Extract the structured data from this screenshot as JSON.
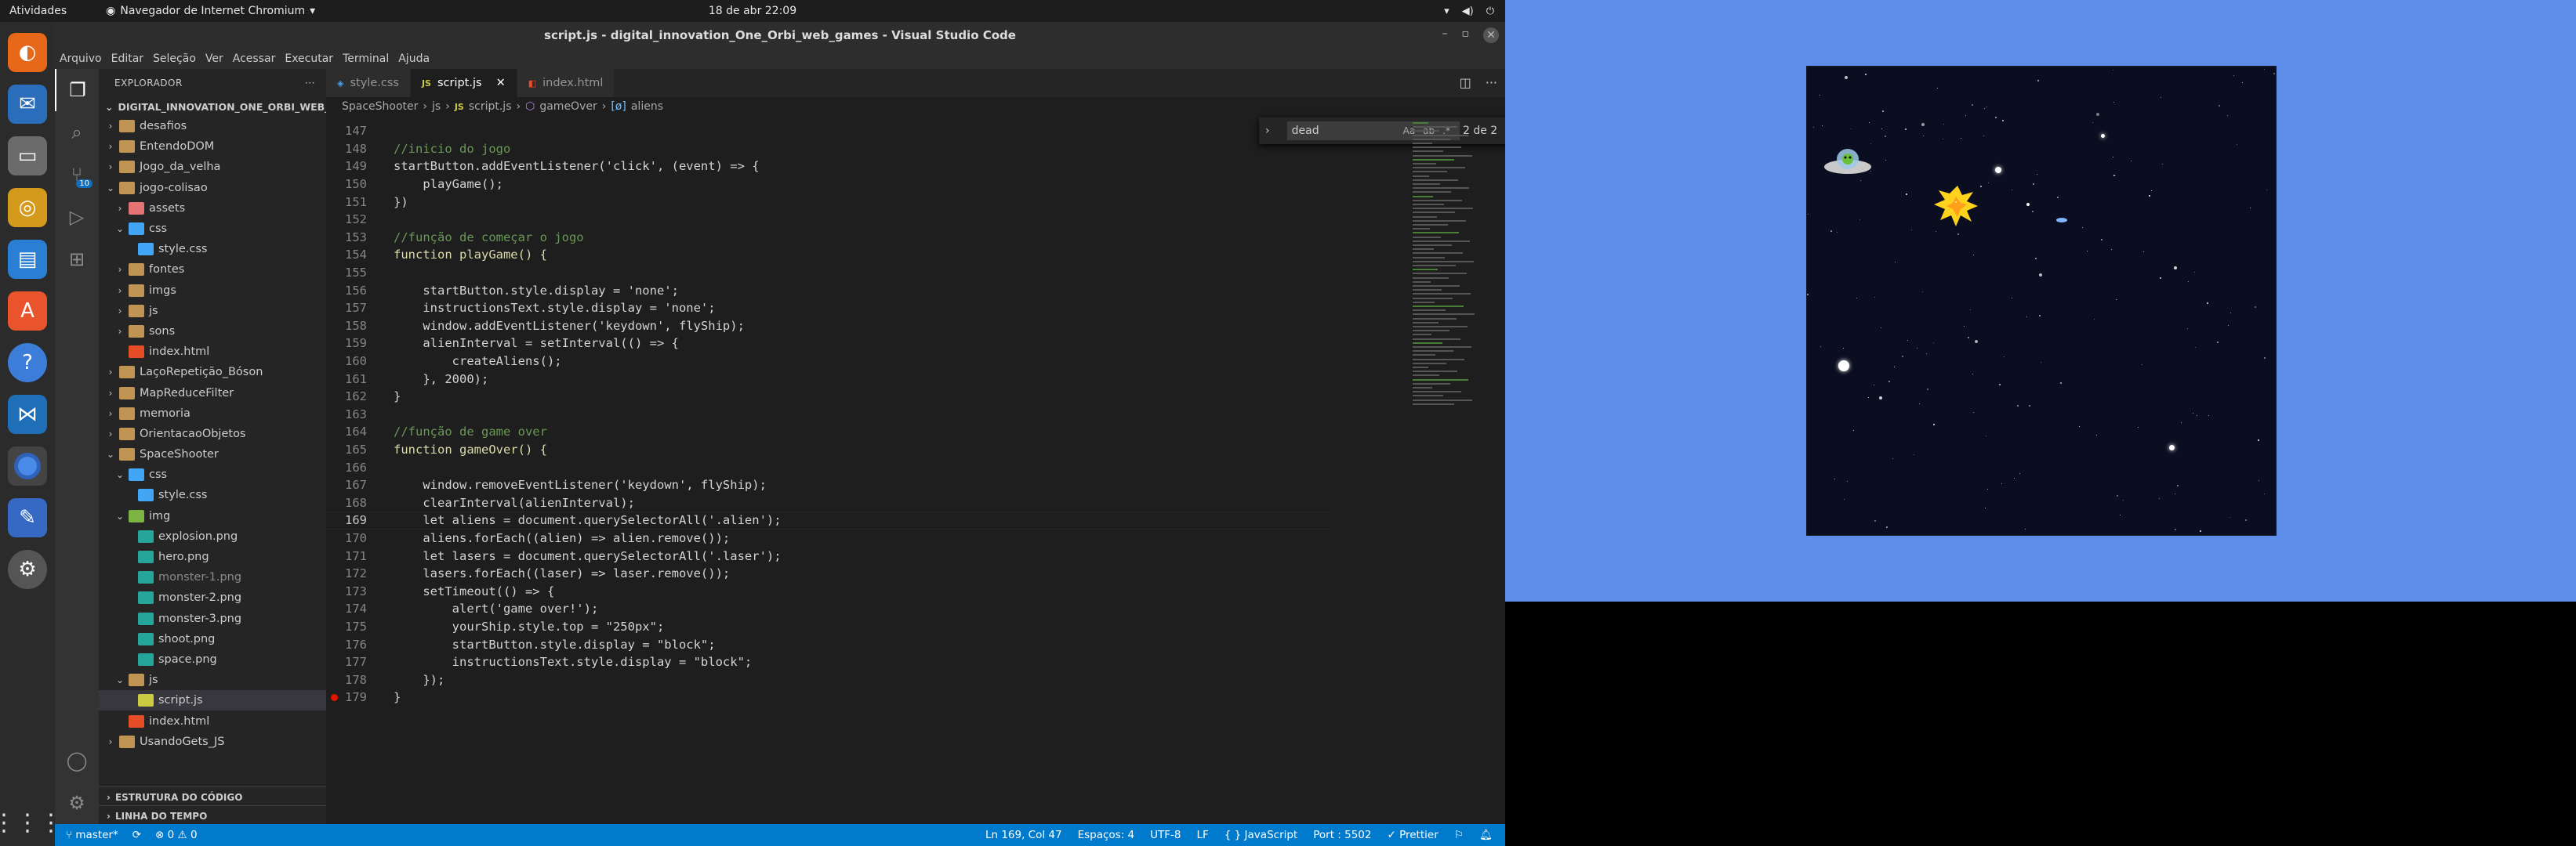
{
  "topbar": {
    "activities": "Atividades",
    "app_menu": "Navegador de Internet Chromium",
    "clock": "18 de abr  22:09"
  },
  "vscode": {
    "window_title": "script.js - digital_innovation_One_Orbi_web_games - Visual Studio Code",
    "menu": [
      "Arquivo",
      "Editar",
      "Seleção",
      "Ver",
      "Acessar",
      "Executar",
      "Terminal",
      "Ajuda"
    ],
    "source_control_badge": "10",
    "explorer": {
      "header": "EXPLORADOR",
      "root": "DIGITAL_INNOVATION_ONE_ORBI_WEB_G...",
      "items": [
        {
          "label": "desafios",
          "kind": "folder"
        },
        {
          "label": "EntendoDOM",
          "kind": "folder"
        },
        {
          "label": "Jogo_da_velha",
          "kind": "folder"
        },
        {
          "label": "jogo-colisao",
          "kind": "folder"
        },
        {
          "label": "assets",
          "kind": "folder-red"
        },
        {
          "label": "css",
          "kind": "folder-blue"
        },
        {
          "label": "style.css",
          "kind": "css"
        },
        {
          "label": "fontes",
          "kind": "folder"
        },
        {
          "label": "imgs",
          "kind": "folder"
        },
        {
          "label": "js",
          "kind": "folder"
        },
        {
          "label": "sons",
          "kind": "folder"
        },
        {
          "label": "index.html",
          "kind": "html"
        },
        {
          "label": "LaçoRepetição_Bóson",
          "kind": "folder"
        },
        {
          "label": "MapReduceFilter",
          "kind": "folder"
        },
        {
          "label": "memoria",
          "kind": "folder"
        },
        {
          "label": "OrientacaoObjetos",
          "kind": "folder"
        },
        {
          "label": "SpaceShooter",
          "kind": "folder"
        },
        {
          "label": "css",
          "kind": "folder-blue"
        },
        {
          "label": "style.css",
          "kind": "css"
        },
        {
          "label": "img",
          "kind": "folder-green"
        },
        {
          "label": "explosion.png",
          "kind": "img"
        },
        {
          "label": "hero.png",
          "kind": "img"
        },
        {
          "label": "monster-1.png",
          "kind": "img"
        },
        {
          "label": "monster-2.png",
          "kind": "img"
        },
        {
          "label": "monster-3.png",
          "kind": "img"
        },
        {
          "label": "shoot.png",
          "kind": "img"
        },
        {
          "label": "space.png",
          "kind": "img"
        },
        {
          "label": "js",
          "kind": "folder"
        },
        {
          "label": "script.js",
          "kind": "js"
        },
        {
          "label": "index.html",
          "kind": "html"
        },
        {
          "label": "UsandoGets_JS",
          "kind": "folder"
        }
      ],
      "outline": "ESTRUTURA DO CÓDIGO",
      "timeline": "LINHA DO TEMPO"
    },
    "tabs": [
      {
        "label": "style.css",
        "icon": "css-file-icon"
      },
      {
        "label": "script.js",
        "icon": "js-file-icon"
      },
      {
        "label": "index.html",
        "icon": "html-file-icon"
      }
    ],
    "breadcrumb": [
      "SpaceShooter",
      "js",
      "script.js",
      "gameOver",
      "aliens"
    ],
    "find": {
      "query": "dead",
      "count": "2 de 2"
    },
    "code": [
      {
        "n": "147",
        "t": ""
      },
      {
        "n": "148",
        "t": "//inicio do jogo"
      },
      {
        "n": "149",
        "t": "startButton.addEventListener('click', (event) => {"
      },
      {
        "n": "150",
        "t": "    playGame();"
      },
      {
        "n": "151",
        "t": "})"
      },
      {
        "n": "152",
        "t": ""
      },
      {
        "n": "153",
        "t": "//função de começar o jogo"
      },
      {
        "n": "154",
        "t": "function playGame() {"
      },
      {
        "n": "155",
        "t": ""
      },
      {
        "n": "156",
        "t": "    startButton.style.display = 'none';"
      },
      {
        "n": "157",
        "t": "    instructionsText.style.display = 'none';"
      },
      {
        "n": "158",
        "t": "    window.addEventListener('keydown', flyShip);"
      },
      {
        "n": "159",
        "t": "    alienInterval = setInterval(() => {"
      },
      {
        "n": "160",
        "t": "        createAliens();"
      },
      {
        "n": "161",
        "t": "    }, 2000);"
      },
      {
        "n": "162",
        "t": "}"
      },
      {
        "n": "163",
        "t": ""
      },
      {
        "n": "164",
        "t": "//função de game over"
      },
      {
        "n": "165",
        "t": "function gameOver() {"
      },
      {
        "n": "166",
        "t": ""
      },
      {
        "n": "167",
        "t": "    window.removeEventListener('keydown', flyShip);"
      },
      {
        "n": "168",
        "t": "    clearInterval(alienInterval);"
      },
      {
        "n": "169",
        "t": "    let aliens = document.querySelectorAll('.alien');"
      },
      {
        "n": "170",
        "t": "    aliens.forEach((alien) => alien.remove());"
      },
      {
        "n": "171",
        "t": "    let lasers = document.querySelectorAll('.laser');"
      },
      {
        "n": "172",
        "t": "    lasers.forEach((laser) => laser.remove());"
      },
      {
        "n": "173",
        "t": "    setTimeout(() => {"
      },
      {
        "n": "174",
        "t": "        alert('game over!');"
      },
      {
        "n": "175",
        "t": "        yourShip.style.top = \"250px\";"
      },
      {
        "n": "176",
        "t": "        startButton.style.display = \"block\";"
      },
      {
        "n": "177",
        "t": "        instructionsText.style.display = \"block\";"
      },
      {
        "n": "178",
        "t": "    });"
      },
      {
        "n": "179",
        "t": "}"
      }
    ],
    "status": {
      "branch": "master*",
      "problems": "⊗ 0 ⚠ 0",
      "position": "Ln 169, Col 47",
      "spaces": "Espaços: 4",
      "encoding": "UTF-8",
      "eol": "LF",
      "language": "{ } JavaScript",
      "port": "Port : 5502",
      "prettier": "✓ Prettier"
    }
  },
  "colors": {
    "accent": "#007acc",
    "browser_bg": "#5e8ee9",
    "game_bg": "#0b0e20"
  }
}
